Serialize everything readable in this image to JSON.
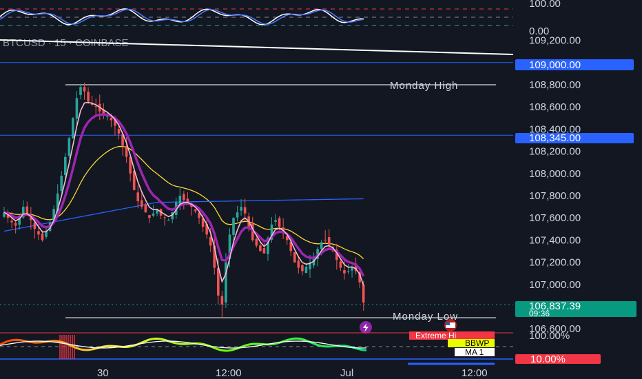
{
  "symbol_title": "BTCUSD · 15 · COINBASE",
  "stoch_axis": [
    "100.00",
    "0.00"
  ],
  "x_ticks": [
    "30",
    "12:00",
    "Jul",
    "12:00"
  ],
  "levels": {
    "monday_high": {
      "label": "Monday High",
      "value": 108800
    },
    "monday_low": {
      "label": "Monday Low",
      "value": 106700
    },
    "blue_upper": {
      "label": "109,000.00",
      "value": 109000
    },
    "blue_lower": {
      "label": "108,345.00",
      "value": 108345
    }
  },
  "price_tag": {
    "value": "106,837.39",
    "countdown": "09:36",
    "price": 106837.39
  },
  "bbwp": {
    "labels": [
      "100.00%",
      "Extreme Hi",
      "BBWP",
      "MA 1",
      "10.00%"
    ],
    "colors": {
      "extreme": "#f23645",
      "bbwp": "#e8ff00",
      "ma": "#ffffff",
      "low": "#f23645"
    }
  },
  "colors": {
    "background": "#131722",
    "up_candle": "#26a69a",
    "down_candle": "#ef5350",
    "ema_fast": "#f8bbd0",
    "ema_mid": "#9c27b0",
    "ma_yellow": "#fdd835",
    "ma_blue": "#2962ff",
    "hline_blue": "#2962ff",
    "tag_green": "#089981",
    "tag_blue": "#2962ff"
  },
  "chart_data": {
    "type": "candlestick",
    "title": "BTCUSD · 15 · COINBASE",
    "y_ticks": [
      "109,200.00",
      "108,800.00",
      "108,600.00",
      "108,400.00",
      "108,200.00",
      "108,000.00",
      "107,800.00",
      "107,600.00",
      "107,400.00",
      "107,200.00",
      "107,000.00",
      "106,600.00"
    ],
    "y_tick_values": [
      109200,
      108800,
      108600,
      108400,
      108200,
      108000,
      107800,
      107600,
      107400,
      107200,
      107000,
      106600
    ],
    "ylim": [
      106500,
      109300
    ],
    "x_ticks": [
      "30",
      "12:00",
      "Jul",
      "12:00"
    ],
    "close": [
      107650,
      107600,
      107560,
      107530,
      107620,
      107700,
      107640,
      107580,
      107500,
      107450,
      107400,
      107480,
      107560,
      107680,
      107820,
      107980,
      108150,
      108320,
      108500,
      108680,
      108780,
      108740,
      108650,
      108620,
      108600,
      108560,
      108540,
      108520,
      108480,
      108430,
      108360,
      108250,
      108150,
      108000,
      107850,
      107750,
      107700,
      107650,
      107600,
      107640,
      107680,
      107620,
      107600,
      107580,
      107650,
      107740,
      107800,
      107760,
      107740,
      107700,
      107660,
      107600,
      107520,
      107450,
      107350,
      107150,
      106900,
      106820,
      107200,
      107450,
      107600,
      107650,
      107700,
      107640,
      107520,
      107400,
      107350,
      107300,
      107280,
      107420,
      107540,
      107580,
      107520,
      107460,
      107400,
      107300,
      107200,
      107150,
      107120,
      107160,
      107200,
      107240,
      107320,
      107380,
      107400,
      107360,
      107300,
      107220,
      107150,
      107100,
      107120,
      107160,
      107120,
      107020,
      106837
    ]
  }
}
